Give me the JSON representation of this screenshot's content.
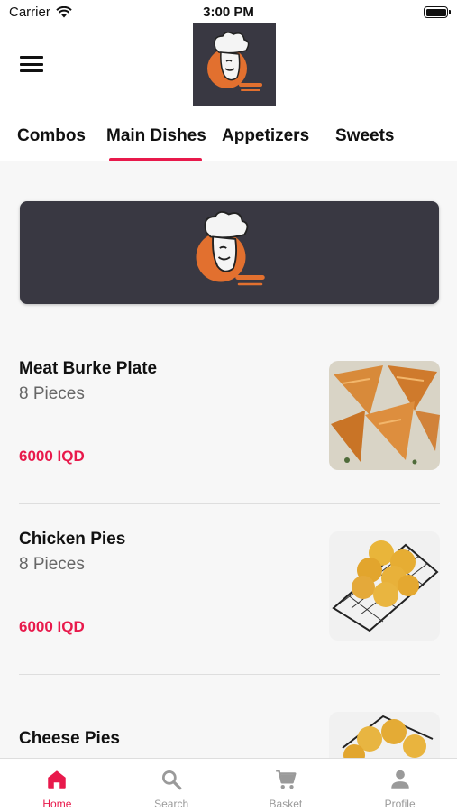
{
  "status_bar": {
    "carrier": "Carrier",
    "time": "3:00 PM"
  },
  "header": {
    "logo_icon": "chef-logo",
    "menu_icon": "hamburger-icon"
  },
  "tabs": [
    {
      "label": "Combos"
    },
    {
      "label": "Main Dishes"
    },
    {
      "label": "Appetizers"
    },
    {
      "label": "Sweets"
    }
  ],
  "selected_tab": "Main Dishes",
  "banner": {
    "image": "restaurant-logo-banner"
  },
  "products": [
    {
      "name": "Meat Burke Plate",
      "description": "8 Pieces",
      "price": "6000 IQD",
      "image": "fried-triangle-pastries"
    },
    {
      "name": "Chicken Pies",
      "description": "8 Pieces",
      "price": "6000 IQD",
      "image": "round-pies-on-rack"
    },
    {
      "name": "Cheese Pies",
      "description": "",
      "price": "",
      "image": "pies-on-rack"
    }
  ],
  "bottom_nav": [
    {
      "label": "Home",
      "icon": "home-icon",
      "active": true
    },
    {
      "label": "Search",
      "icon": "search-icon",
      "active": false
    },
    {
      "label": "Basket",
      "icon": "cart-icon",
      "active": false
    },
    {
      "label": "Profile",
      "icon": "person-icon",
      "active": false
    }
  ],
  "colors": {
    "accent": "#e8194b",
    "logo_bg": "#393842",
    "logo_orange": "#e2702f"
  }
}
